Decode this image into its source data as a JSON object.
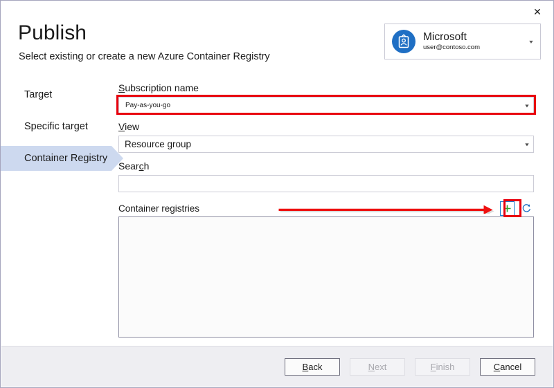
{
  "window": {
    "close_label": "✕"
  },
  "header": {
    "title": "Publish",
    "subtitle": "Select existing or create a new Azure Container Registry"
  },
  "account": {
    "name": "Microsoft",
    "email": "user@contoso.com",
    "caret": "▾",
    "avatar_icon": "id-badge-icon"
  },
  "sidebar": {
    "items": [
      {
        "label": "Target",
        "selected": false
      },
      {
        "label": "Specific target",
        "selected": false
      },
      {
        "label": "Container Registry",
        "selected": true
      }
    ]
  },
  "form": {
    "subscription": {
      "label_prefix": "",
      "label_accel": "S",
      "label_rest": "ubscription name",
      "value": "Pay-as-you-go",
      "caret": "▾",
      "highlighted": true
    },
    "view": {
      "label_accel": "V",
      "label_rest": "iew",
      "value": "Resource group",
      "caret": "▾"
    },
    "search": {
      "label_pre": "Sear",
      "label_accel": "c",
      "label_post": "h",
      "value": "",
      "placeholder": ""
    },
    "registries": {
      "label": "Container registries",
      "items": [],
      "add_icon": "plus-icon",
      "refresh_icon": "refresh-icon",
      "add_title": "New",
      "refresh_title": "Refresh"
    }
  },
  "annotation": {
    "arrow_color": "#ee1111",
    "highlight_color": "#e8000d",
    "points_to": "plus-icon"
  },
  "footer": {
    "buttons": [
      {
        "pre": "",
        "accel": "B",
        "post": "ack",
        "enabled": true
      },
      {
        "pre": "",
        "accel": "N",
        "post": "ext",
        "enabled": false
      },
      {
        "pre": "",
        "accel": "F",
        "post": "inish",
        "enabled": false
      },
      {
        "pre": "",
        "accel": "C",
        "post": "ancel",
        "enabled": true
      }
    ]
  },
  "colors": {
    "accent_blue": "#1b7fd1",
    "nav_selected": "#cdd9ef",
    "annotation_red": "#e8000d",
    "plus_green": "#2fa32f"
  }
}
